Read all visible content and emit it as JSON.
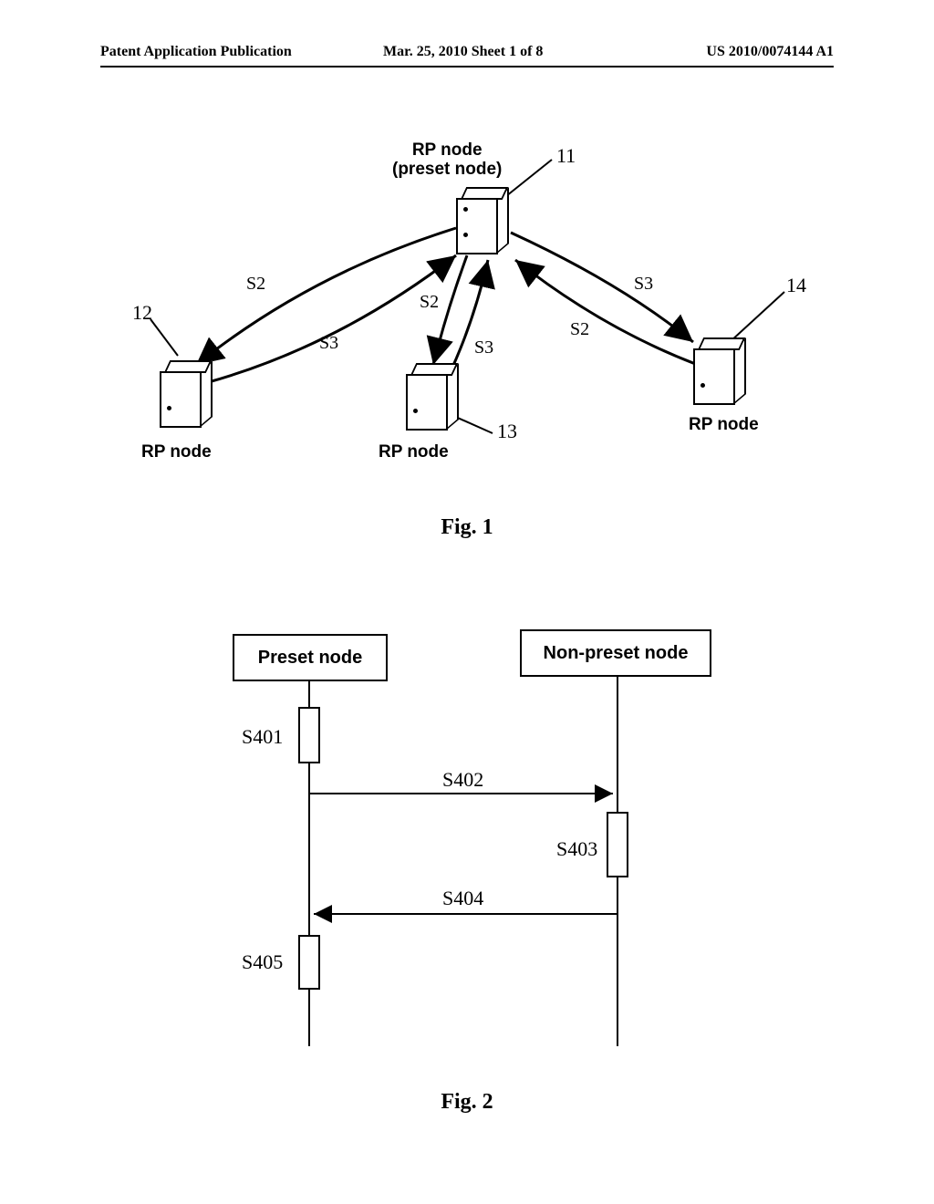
{
  "header": {
    "left": "Patent Application Publication",
    "mid": "Mar. 25, 2010  Sheet 1 of 8",
    "right": "US 2010/0074144 A1"
  },
  "fig1": {
    "caption": "Fig. 1",
    "node11": {
      "ref": "11",
      "line1": "RP node",
      "line2": "(preset node)",
      "name": "RP node (preset node)"
    },
    "node12": {
      "ref": "12",
      "name": "RP node"
    },
    "node13": {
      "ref": "13",
      "name": "RP node"
    },
    "node14": {
      "ref": "14",
      "name": "RP node"
    },
    "edges": {
      "e12_s2": "S2",
      "e12_s3": "S3",
      "e13_s2": "S2",
      "e13_s3": "S3",
      "e14_s2": "S2",
      "e14_s3": "S3"
    }
  },
  "fig2": {
    "caption": "Fig. 2",
    "preset_label": "Preset node",
    "nonpreset_label": "Non-preset node",
    "steps": {
      "s401": "S401",
      "s402": "S402",
      "s403": "S403",
      "s404": "S404",
      "s405": "S405"
    }
  }
}
